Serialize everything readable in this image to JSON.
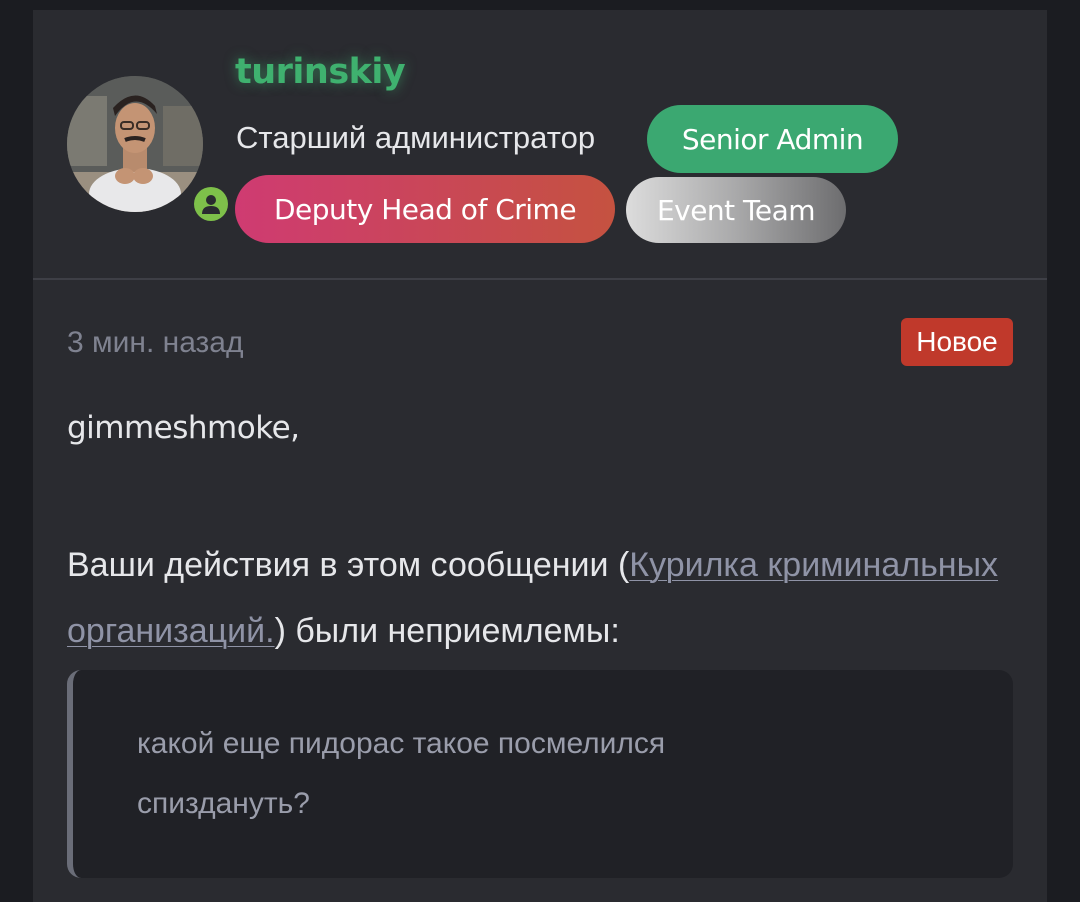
{
  "profile": {
    "username": "turinskiy",
    "title": "Старший администратор",
    "status_icon": "user-online-icon",
    "badges": [
      {
        "label": "Senior Admin",
        "color": "#3ba871"
      },
      {
        "label": "Deputy Head of Crime",
        "color": "#cf3b72"
      },
      {
        "label": "Event Team",
        "color": "#a9a9aa"
      }
    ]
  },
  "post": {
    "time": "3 мин. назад",
    "new_label": "Новое",
    "greeting": "gimmeshmoke,",
    "message_before": "Ваши действия в этом сообщении (",
    "link_text": "Курилка криминальных организаций.",
    "message_after": ") были неприемлемы:",
    "quote": "какой еще пидорас такое посмелился спиздануть?"
  },
  "colors": {
    "background": "#1b1c21",
    "card": "#2a2b30",
    "username": "#3fb16f",
    "new_badge": "#c0392b",
    "link": "#8f93a6"
  }
}
